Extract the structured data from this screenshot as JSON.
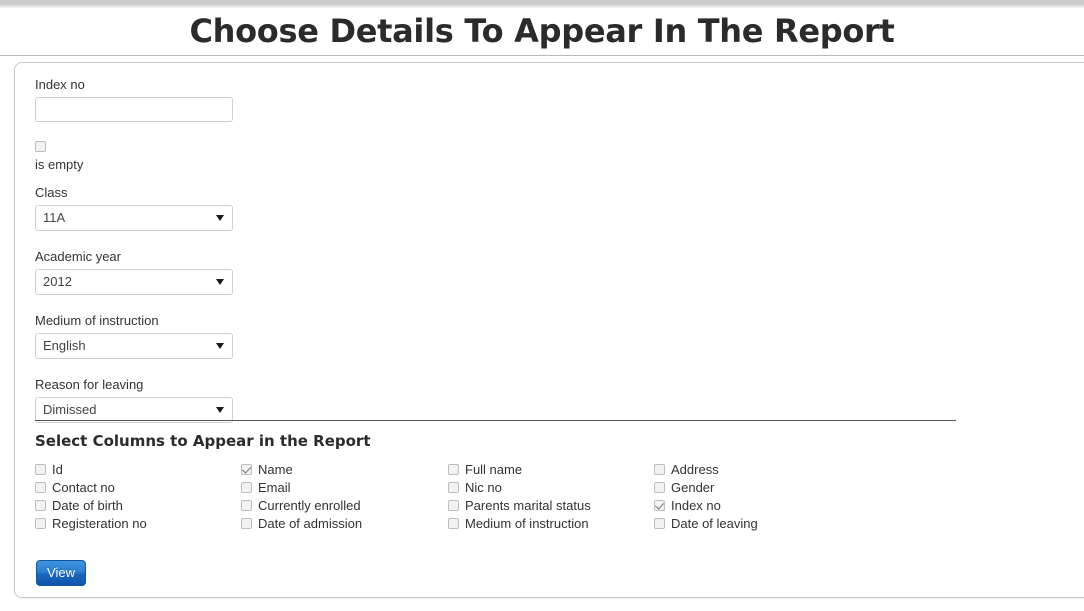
{
  "header": {
    "title": "Choose Details To Appear In The Report"
  },
  "filters": {
    "index_no": {
      "label": "Index no",
      "value": "",
      "placeholder": ""
    },
    "is_empty": {
      "label": "is empty",
      "checked": false
    },
    "class": {
      "label": "Class",
      "value": "11A"
    },
    "academic_year": {
      "label": "Academic year",
      "value": "2012"
    },
    "medium_of_instruction": {
      "label": "Medium of instruction",
      "value": "English"
    },
    "reason_for_leaving": {
      "label": "Reason for leaving",
      "value": "Dimissed"
    }
  },
  "columns_section": {
    "title": "Select Columns to Appear in the Report",
    "columns": [
      [
        {
          "label": "Id",
          "checked": false
        },
        {
          "label": "Contact no",
          "checked": false
        },
        {
          "label": "Date of birth",
          "checked": false
        },
        {
          "label": "Registeration no",
          "checked": false
        }
      ],
      [
        {
          "label": "Name",
          "checked": true
        },
        {
          "label": "Email",
          "checked": false
        },
        {
          "label": "Currently enrolled",
          "checked": false
        },
        {
          "label": "Date of admission",
          "checked": false
        }
      ],
      [
        {
          "label": "Full name",
          "checked": false
        },
        {
          "label": "Nic no",
          "checked": false
        },
        {
          "label": "Parents marital status",
          "checked": false
        },
        {
          "label": "Medium of instruction",
          "checked": false
        }
      ],
      [
        {
          "label": "Address",
          "checked": false
        },
        {
          "label": "Gender",
          "checked": false
        },
        {
          "label": "Index no",
          "checked": true
        },
        {
          "label": "Date of leaving",
          "checked": false
        }
      ]
    ]
  },
  "actions": {
    "view_label": "View"
  },
  "colors": {
    "accent": "#1a66bd",
    "text": "#333333",
    "border": "#cfcfcf",
    "divider": "#555555"
  }
}
